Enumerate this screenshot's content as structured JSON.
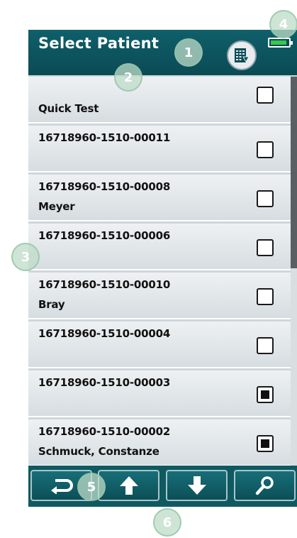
{
  "header": {
    "title": "Select Patient",
    "list_icon": "patient-list-icon",
    "battery_icon": "battery-icon",
    "battery_level": 0.9
  },
  "patients": [
    {
      "line1": "",
      "line2": "Quick Test",
      "checked": false
    },
    {
      "line1": "16718960-1510-00011",
      "line2": "",
      "checked": false
    },
    {
      "line1": "16718960-1510-00008",
      "line2": "Meyer",
      "checked": false
    },
    {
      "line1": "16718960-1510-00006",
      "line2": "",
      "checked": false
    },
    {
      "line1": "16718960-1510-00010",
      "line2": "Bray",
      "checked": false
    },
    {
      "line1": "16718960-1510-00004",
      "line2": "",
      "checked": false
    },
    {
      "line1": "16718960-1510-00003",
      "line2": "",
      "checked": true
    },
    {
      "line1": "16718960-1510-00002",
      "line2": "Schmuck, Constanze",
      "checked": true
    }
  ],
  "footer": {
    "buttons": [
      "back-icon",
      "arrow-up-icon",
      "arrow-down-icon",
      "search-icon"
    ]
  },
  "callouts": [
    "1",
    "2",
    "3",
    "4",
    "5",
    "6"
  ],
  "colors": {
    "header_bg": "#0a4b55",
    "footer_bg": "#0f5961",
    "battery_fill": "#37c84a",
    "callout": "#bedcc8"
  }
}
